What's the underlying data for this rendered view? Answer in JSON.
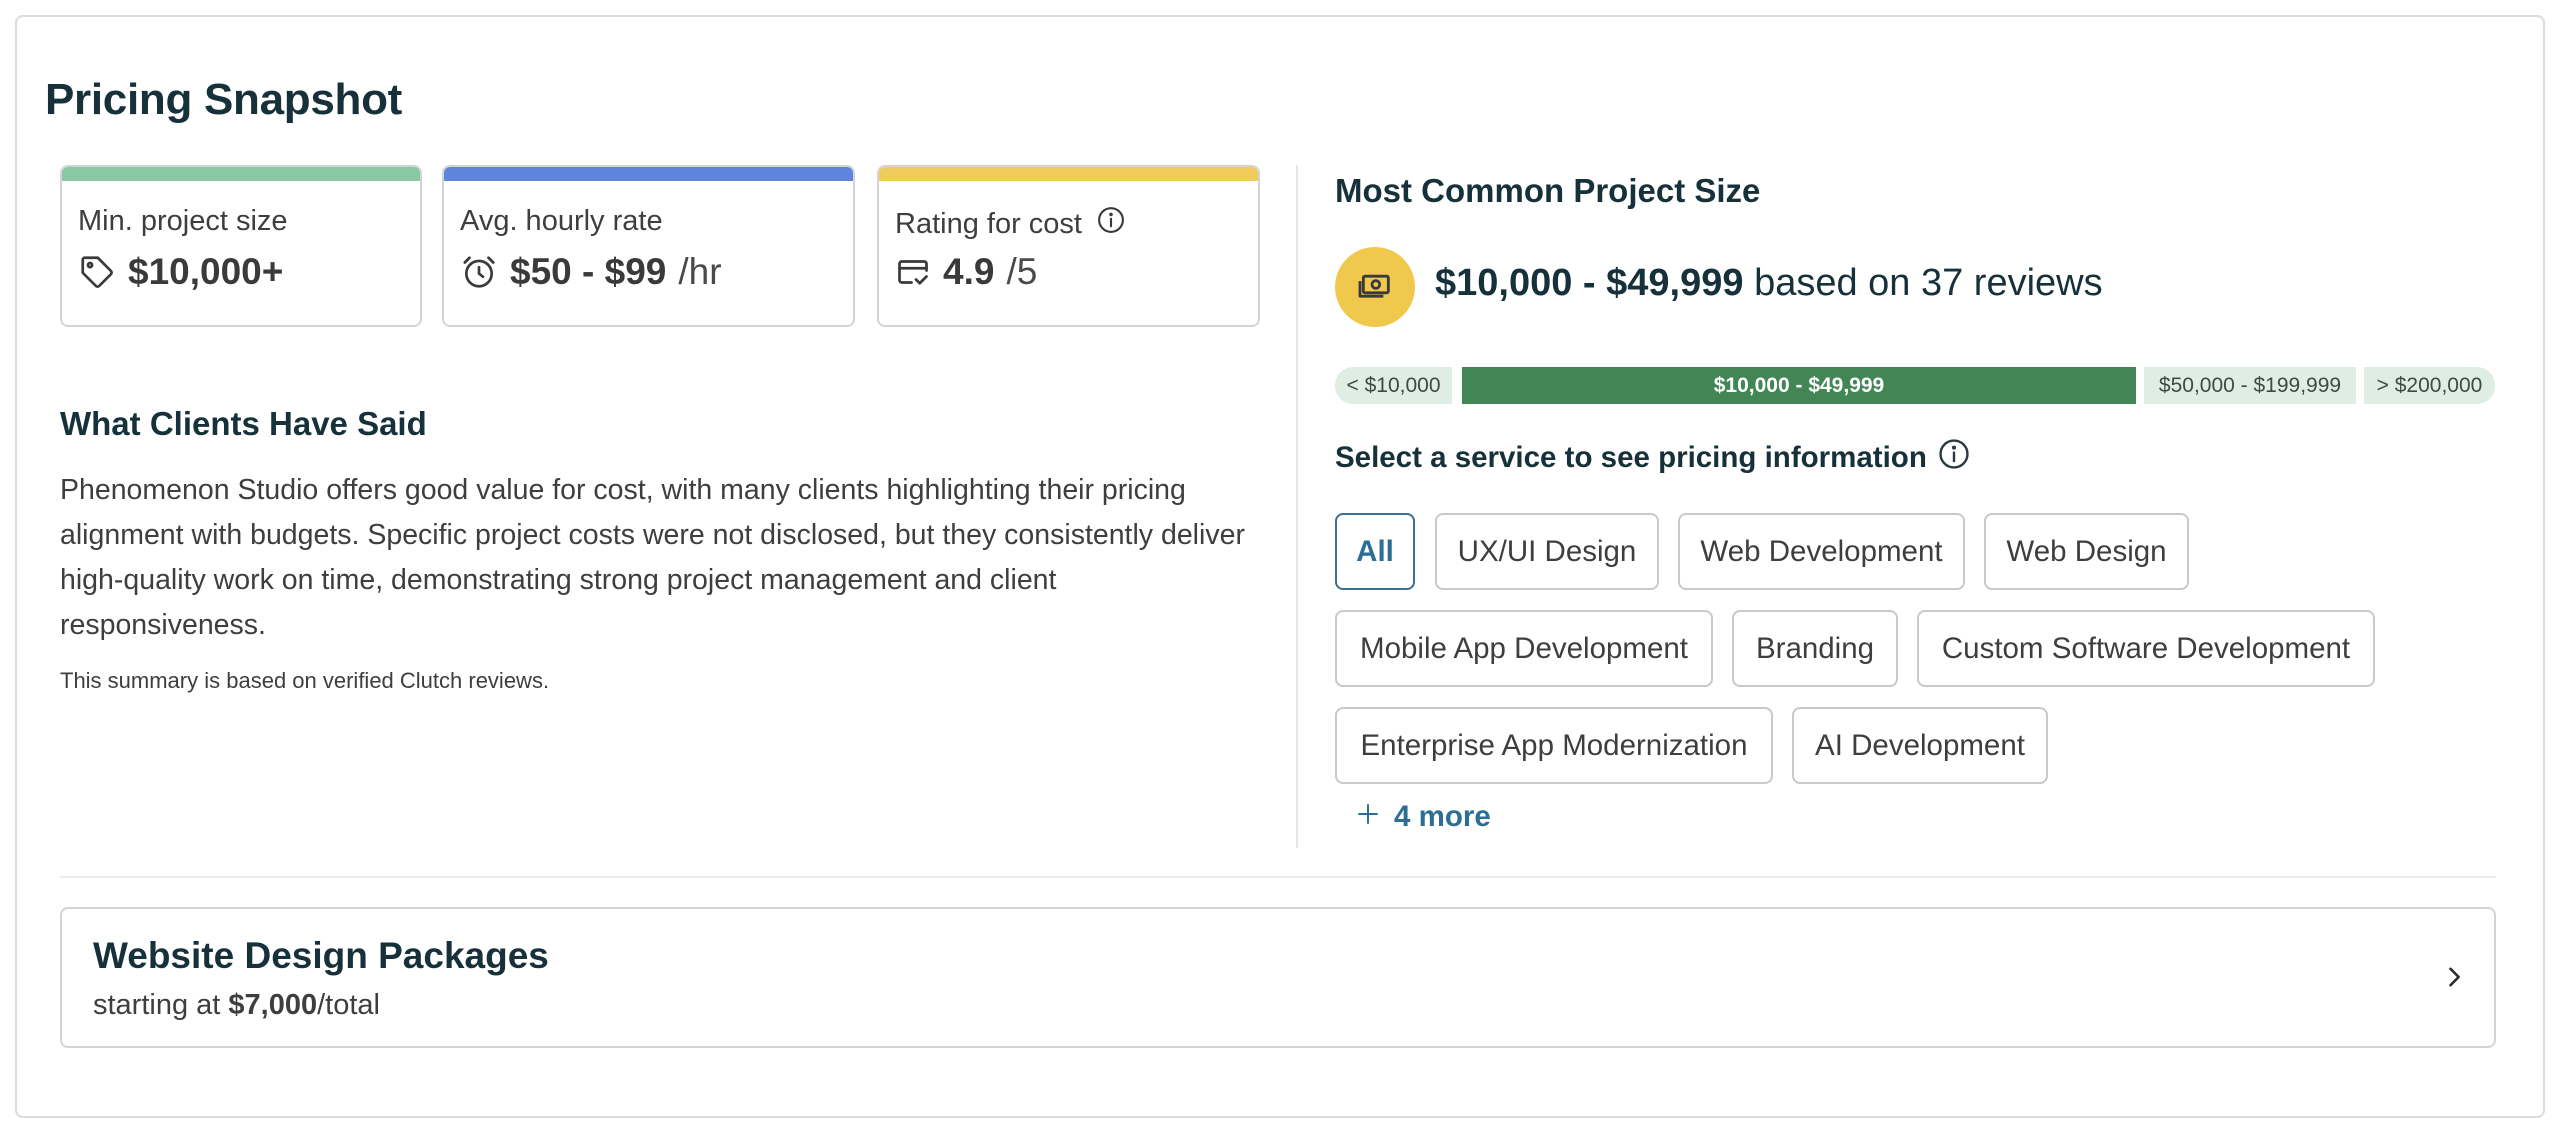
{
  "title": "Pricing Snapshot",
  "stats": {
    "min_project": {
      "label": "Min. project size",
      "value": "$10,000+",
      "icon": "tag-icon",
      "accent": "#88c9a4"
    },
    "hourly": {
      "label": "Avg. hourly rate",
      "value": "$50 - $99",
      "unit": "/hr",
      "icon": "alarm-clock-icon",
      "accent": "#5e84dc"
    },
    "rating": {
      "label": "Rating for cost",
      "value": "4.9",
      "unit": "/5",
      "icon": "card-check-icon",
      "accent": "#efcb5a"
    }
  },
  "clients": {
    "heading": "What Clients Have Said",
    "summary": "Phenomenon Studio offers good value for cost, with many clients highlighting their pricing alignment with budgets. Specific project costs were not disclosed, but they consistently deliver high-quality work on time, demonstrating strong project management and client responsiveness.",
    "note": "This summary is based on verified Clutch reviews."
  },
  "project_size": {
    "heading": "Most Common Project Size",
    "range": "$10,000 - $49,999",
    "reviews_text": "based on 37 reviews",
    "segments": [
      {
        "label": "< $10,000",
        "active": false
      },
      {
        "label": "$10,000 - $49,999",
        "active": true
      },
      {
        "label": "$50,000 - $199,999",
        "active": false
      },
      {
        "label": "> $200,000",
        "active": false
      }
    ]
  },
  "services": {
    "heading": "Select a service to see pricing information",
    "chips": [
      {
        "label": "All",
        "active": true
      },
      {
        "label": "UX/UI Design",
        "active": false
      },
      {
        "label": "Web Development",
        "active": false
      },
      {
        "label": "Web Design",
        "active": false
      },
      {
        "label": "Mobile App Development",
        "active": false
      },
      {
        "label": "Branding",
        "active": false
      },
      {
        "label": "Custom Software Development",
        "active": false
      },
      {
        "label": "Enterprise App Modernization",
        "active": false
      },
      {
        "label": "AI Development",
        "active": false
      }
    ],
    "more_label": "4 more"
  },
  "package": {
    "title": "Website Design Packages",
    "prefix": "starting at",
    "price": "$7,000",
    "suffix": "/total"
  },
  "colors": {
    "active_segment": "#438656",
    "segment_bg": "#dfeee4",
    "link_blue": "#2c6f93",
    "money_circle": "#f0c94c"
  }
}
